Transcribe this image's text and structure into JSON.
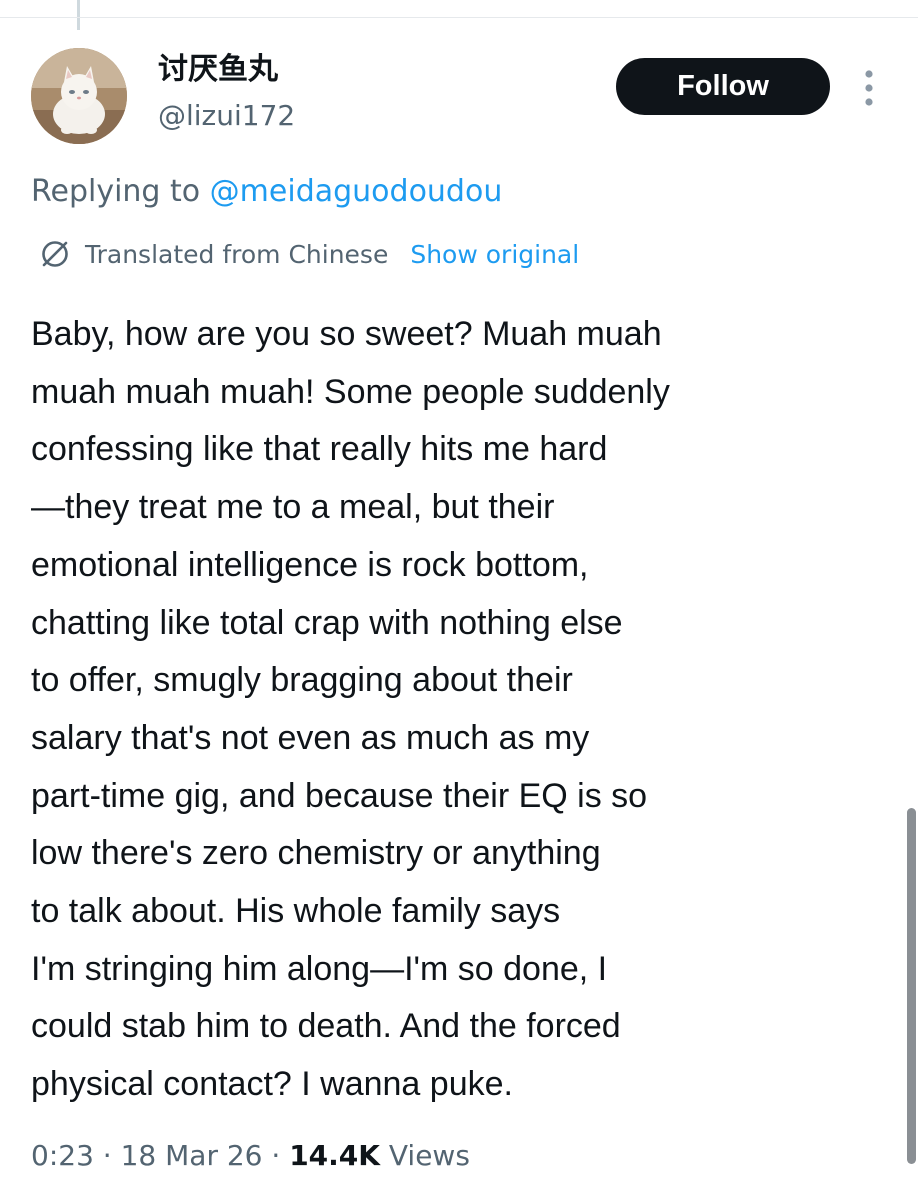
{
  "tweet": {
    "author": {
      "display_name": "讨厌鱼丸",
      "handle": "@lizui172",
      "avatar_icon": "cat-avatar-icon"
    },
    "follow_label": "Follow",
    "more_icon": "more-vertical-icon",
    "replying_prefix": "Replying to ",
    "replying_to": "@meidaguodoudou",
    "translation": {
      "icon": "translate-icon",
      "label": "Translated from Chinese",
      "show_original_label": "Show original"
    },
    "body_lines": [
      "Baby, how are you so sweet? Muah muah",
      "muah muah muah! Some people suddenly",
      "confessing like that really hits me hard",
      "—they treat me to a meal, but their",
      "emotional intelligence is rock bottom,",
      "chatting like total crap with nothing else",
      "to offer, smugly bragging about their",
      "salary that's not even as much as my",
      "part-time gig, and because their EQ is so",
      "low there's zero chemistry or anything",
      "to talk about. His whole family says",
      "I'm stringing him along—I'm so done, I",
      "could stab him to death. And the forced",
      "physical contact? I wanna puke."
    ],
    "time": "0:23",
    "separator": " · ",
    "date": "18 Mar 26",
    "views_count": "14.4K",
    "views_label": " Views"
  },
  "colors": {
    "text_primary": "#0f1419",
    "text_secondary": "#536471",
    "link_blue": "#1d9bf0",
    "follow_bg": "#0f1419"
  }
}
